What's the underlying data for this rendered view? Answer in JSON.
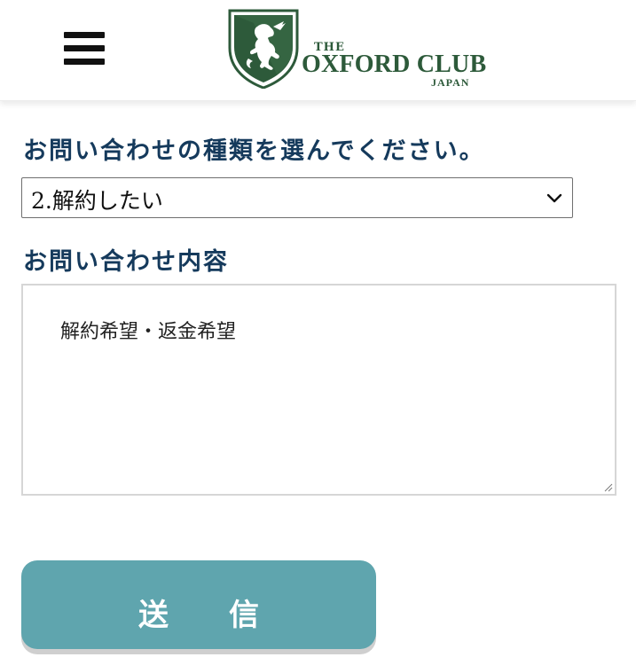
{
  "header": {
    "menu_icon": "hamburger-menu-icon",
    "logo": {
      "the": "THE",
      "name": "OXFORD CLUB",
      "sub": "JAPAN"
    }
  },
  "form": {
    "type_label": "お問い合わせの種類を選んでください。",
    "type_selected": "2.解約したい",
    "content_label": "お問い合わせ内容",
    "content_value": "解約希望・返金希望",
    "submit_label": "送　　信"
  },
  "colors": {
    "brand_green": "#2d5a3a",
    "label_navy": "#153a5c",
    "submit_teal": "#5fa5ae"
  }
}
